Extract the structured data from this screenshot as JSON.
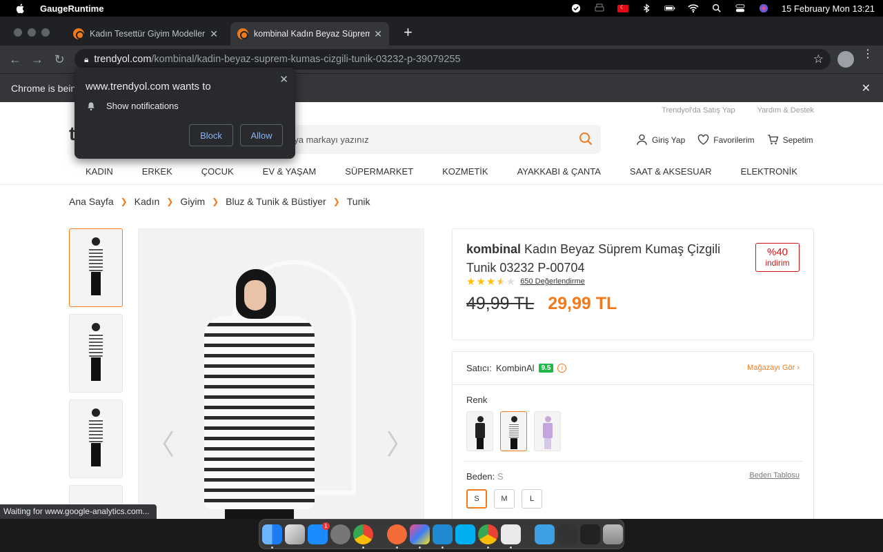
{
  "menubar": {
    "app_name": "GaugeRuntime",
    "datetime": "15 February Mon  13:21"
  },
  "browser": {
    "tabs": [
      {
        "title": "Kadın Tesettür Giyim Modelleri",
        "active": false
      },
      {
        "title": "kombinal Kadın Beyaz Süprem",
        "active": true
      }
    ],
    "url_host": "trendyol.com",
    "url_path": "/kombinal/kadin-beyaz-suprem-kumas-cizgili-tunik-03232-p-39079255",
    "infobar_text": "Chrome is bein",
    "status_text": "Waiting for www.google-analytics.com..."
  },
  "permission_popup": {
    "title": "www.trendyol.com wants to",
    "permission": "Show notifications",
    "block_label": "Block",
    "allow_label": "Allow"
  },
  "site": {
    "top_links": [
      "Trendyol'da Satış Yap",
      "Yardım & Destek"
    ],
    "logo_letter": "t",
    "search_placeholder": "i veya markayı yazınız",
    "user_actions": [
      "Giriş Yap",
      "Favorilerim",
      "Sepetim"
    ],
    "categories": [
      "KADIN",
      "ERKEK",
      "ÇOCUK",
      "EV & YAŞAM",
      "SÜPERMARKET",
      "KOZMETİK",
      "AYAKKABI & ÇANTA",
      "SAAT & AKSESUAR",
      "ELEKTRONİK"
    ],
    "breadcrumbs": [
      "Ana Sayfa",
      "Kadın",
      "Giyim",
      "Bluz & Tunik & Büstiyer",
      "Tunik"
    ]
  },
  "product": {
    "brand": "kombinal",
    "name": "Kadın Beyaz Süprem Kumaş Çizgili Tunik 03232 P-00704",
    "discount_pct": "%40",
    "discount_label": "indirim",
    "rating_stars": 3.5,
    "rating_count": "650 Değerlendirme",
    "old_price": "49,99 TL",
    "new_price": "29,99 TL",
    "seller_label": "Satıcı:",
    "seller_name": "KombinAl",
    "seller_score": "9.5",
    "store_link": "Mağazayı Gör",
    "color_label": "Renk",
    "size_label": "Beden:",
    "selected_size": "S",
    "size_chart": "Beden Tablosu",
    "sizes": [
      "S",
      "M",
      "L"
    ],
    "accent_color": "#f27a1a"
  }
}
